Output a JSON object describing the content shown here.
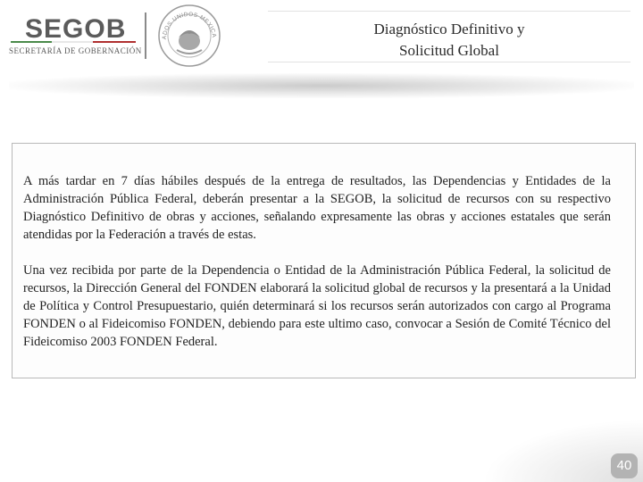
{
  "header": {
    "logo_word": "SEGOB",
    "logo_subtitle": "SECRETARÍA DE GOBERNACIÓN",
    "seal_text": "ESTADOS UNIDOS MEXICANOS",
    "title_line1": "Diagnóstico Definitivo y",
    "title_line2": "Solicitud Global"
  },
  "brand_colors": [
    "#4a8a4a",
    "#ffffff",
    "#b03030"
  ],
  "content": {
    "paragraph1": "A más tardar en 7 días hábiles después de la entrega de resultados, las Dependencias y Entidades de la Administración Pública Federal, deberán presentar a la SEGOB, la solicitud de recursos con su respectivo Diagnóstico Definitivo de obras y acciones, señalando expresamente las obras y acciones estatales que serán atendidas por la Federación a través de estas.",
    "paragraph2": "Una vez recibida por parte de la Dependencia o Entidad de la Administración Pública Federal, la solicitud de recursos, la Dirección General del FONDEN elaborará la solicitud global de recursos y la presentará a la Unidad de Política y Control Presupuestario, quién determinará si los recursos serán autorizados con cargo al Programa FONDEN o al Fideicomiso FONDEN, debiendo para este ultimo caso, convocar a Sesión de Comité Técnico del Fideicomiso 2003 FONDEN Federal."
  },
  "footer": {
    "page_number": "40"
  }
}
